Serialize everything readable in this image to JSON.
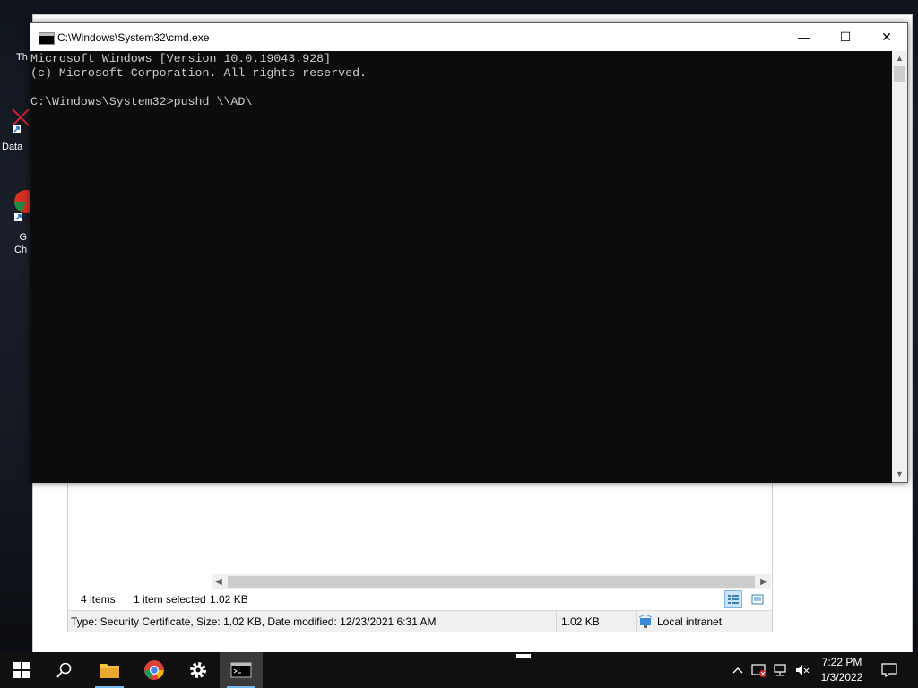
{
  "desktop": {
    "icons": [
      {
        "label": "Th"
      },
      {
        "label": "Data"
      },
      {
        "label": "G\nCh"
      }
    ]
  },
  "cmd": {
    "title": "C:\\Windows\\System32\\cmd.exe",
    "minimize": "—",
    "maximize": "☐",
    "close": "✕",
    "lines": [
      "Microsoft Windows [Version 10.0.19043.928]",
      "(c) Microsoft Corporation. All rights reserved.",
      "",
      "C:\\Windows\\System32>pushd \\\\AD\\"
    ]
  },
  "explorer": {
    "item_count": "4 items",
    "selection": "1 item selected",
    "selection_size": "1.02 KB",
    "details": "Type: Security Certificate, Size: 1.02 KB, Date modified: 12/23/2021 6:31 AM",
    "details_size": "1.02 KB",
    "zone": "Local intranet"
  },
  "taskbar": {
    "clock_time": "7:22 PM",
    "clock_date": "1/3/2022"
  },
  "colors": {
    "console_bg": "#0c0c0c",
    "console_fg": "#cccccc",
    "taskbar_bg": "#101010",
    "accent": "#76b9ed"
  }
}
